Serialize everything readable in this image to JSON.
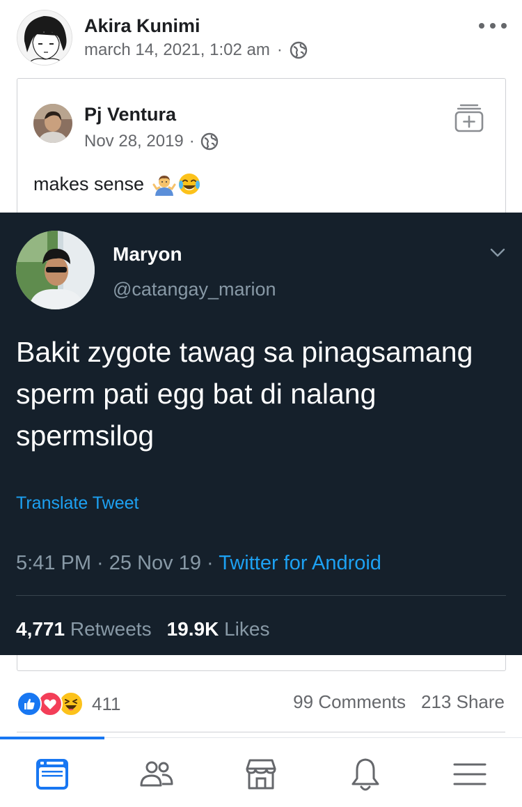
{
  "post": {
    "author_name": "Akira Kunimi",
    "timestamp": "march 14, 2021, 1:02 am",
    "separator": "·",
    "privacy_icon": "globe-icon",
    "more_icon": "more-horizontal-icon"
  },
  "shared": {
    "author_name": "Pj Ventura",
    "date": "Nov 28, 2019",
    "separator": "·",
    "privacy_icon": "globe-icon",
    "save_icon": "save-collection-icon",
    "caption": "makes sense",
    "caption_emojis": [
      "person-shrugging-emoji",
      "face-with-tears-of-joy-emoji"
    ]
  },
  "tweet": {
    "name": "Maryon",
    "handle": "@catangay_marion",
    "text": "Bakit zygote tawag sa pinagsamang sperm pati egg bat di nalang spermsilog",
    "translate_label": "Translate Tweet",
    "time": "5:41 PM · 25 Nov 19 · ",
    "source": "Twitter for Android",
    "retweets_count": "4,771",
    "retweets_label": " Retweets",
    "likes_count": "19.9K",
    "likes_label": " Likes",
    "colors": {
      "background": "#15202b",
      "accent": "#1da1f2",
      "muted": "#8899a6"
    }
  },
  "engagement": {
    "reaction_icons": [
      "like-reaction-icon",
      "love-reaction-icon",
      "haha-reaction-icon"
    ],
    "reactions_count": "411",
    "comments": "99 Comments",
    "shares": "213 Share"
  },
  "nav": {
    "items": [
      {
        "name": "news-feed-icon",
        "active": true
      },
      {
        "name": "friends-icon",
        "active": false
      },
      {
        "name": "marketplace-icon",
        "active": false
      },
      {
        "name": "notifications-bell-icon",
        "active": false
      },
      {
        "name": "menu-icon",
        "active": false
      }
    ],
    "accent": "#1877f2"
  }
}
